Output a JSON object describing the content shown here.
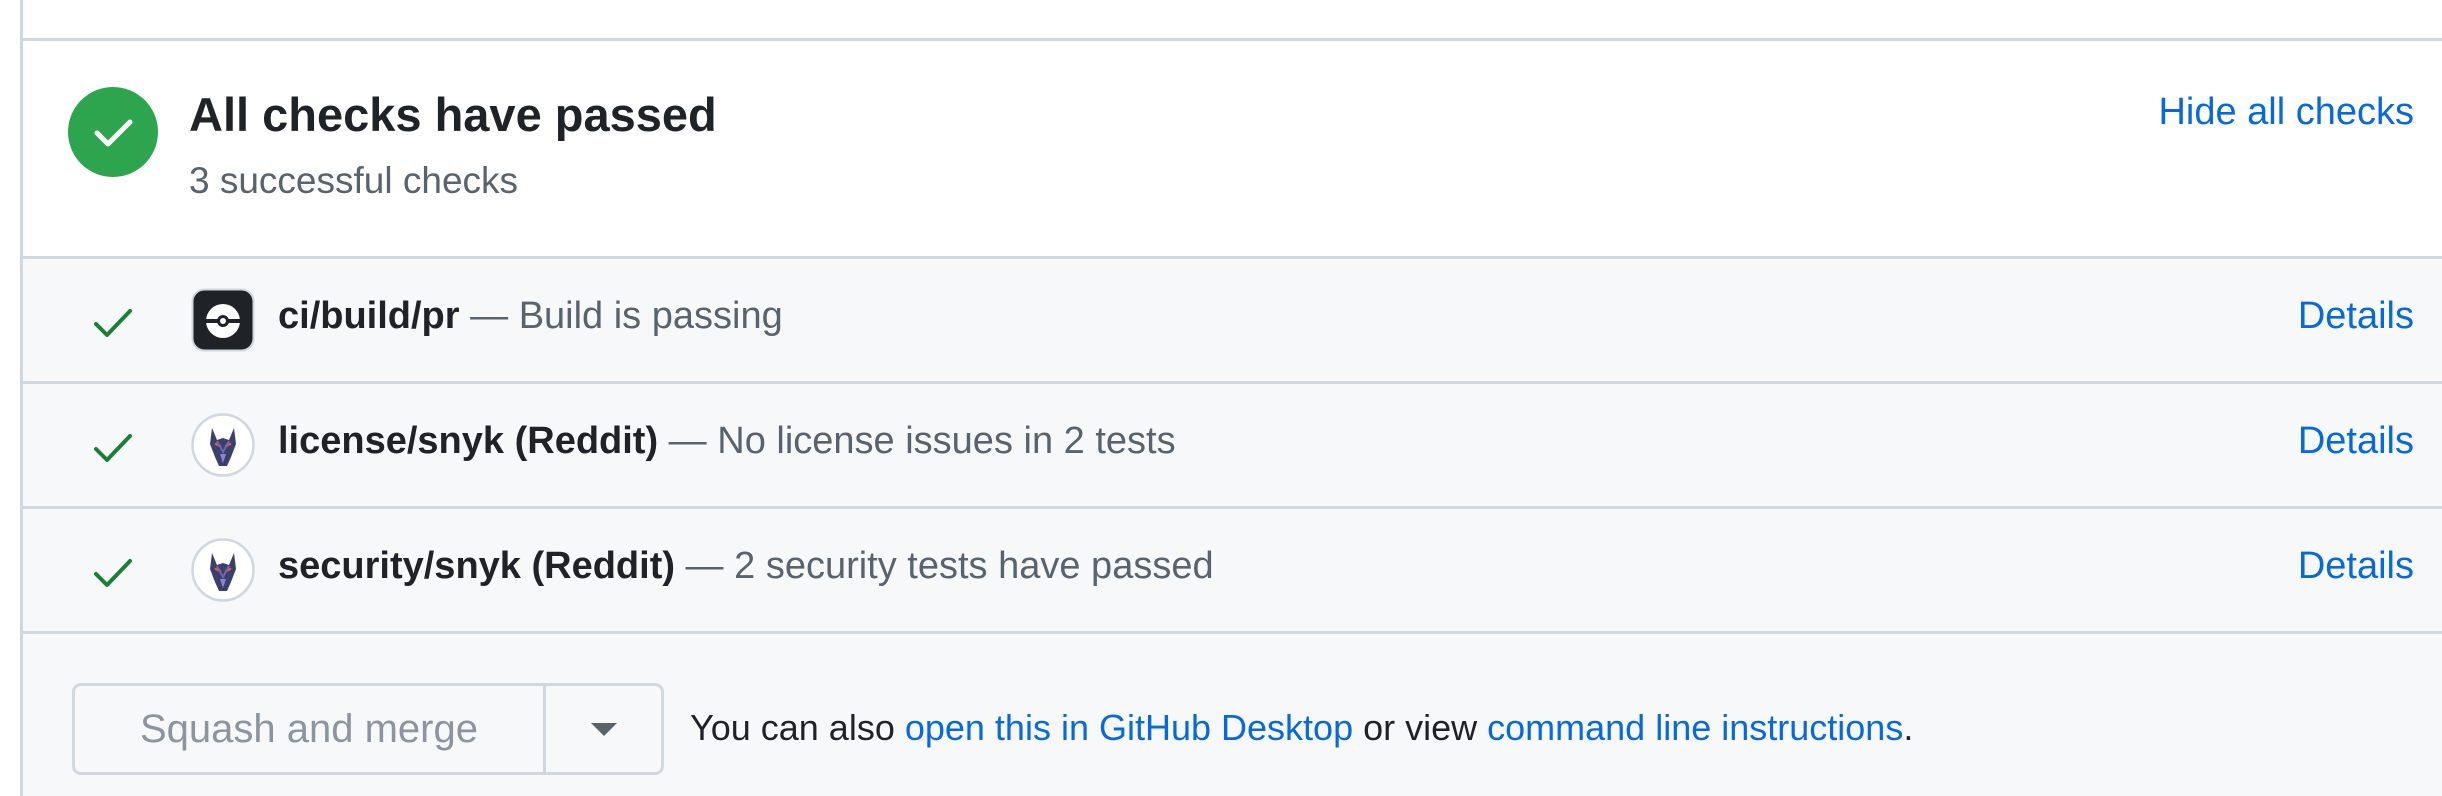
{
  "summary": {
    "title": "All checks have passed",
    "subtitle": "3 successful checks",
    "hide_link": "Hide all checks",
    "status_icon": "check-circle-icon"
  },
  "checks": [
    {
      "name": "ci/build/pr",
      "separator": " — ",
      "description": "Build is passing",
      "details": "Details",
      "app_icon": "ci-app-icon"
    },
    {
      "name": "license/snyk (Reddit)",
      "separator": " — ",
      "description": "No license issues in 2 tests",
      "details": "Details",
      "app_icon": "snyk-doberman-icon"
    },
    {
      "name": "security/snyk (Reddit)",
      "separator": " — ",
      "description": "2 security tests have passed",
      "details": "Details",
      "app_icon": "snyk-doberman-icon"
    }
  ],
  "merge": {
    "button_label": "Squash and merge",
    "dropdown_icon": "triangle-down-icon",
    "note_prefix": "You can also ",
    "desktop_link": "open this in GitHub Desktop",
    "note_middle": " or view ",
    "cli_link": "command line instructions",
    "note_suffix": "."
  },
  "colors": {
    "success": "#2da44e",
    "check_mark": "#1a7f37",
    "link": "#0969da",
    "muted_text": "#59636e",
    "border": "#d0d7de",
    "row_bg": "#f6f8fa"
  }
}
